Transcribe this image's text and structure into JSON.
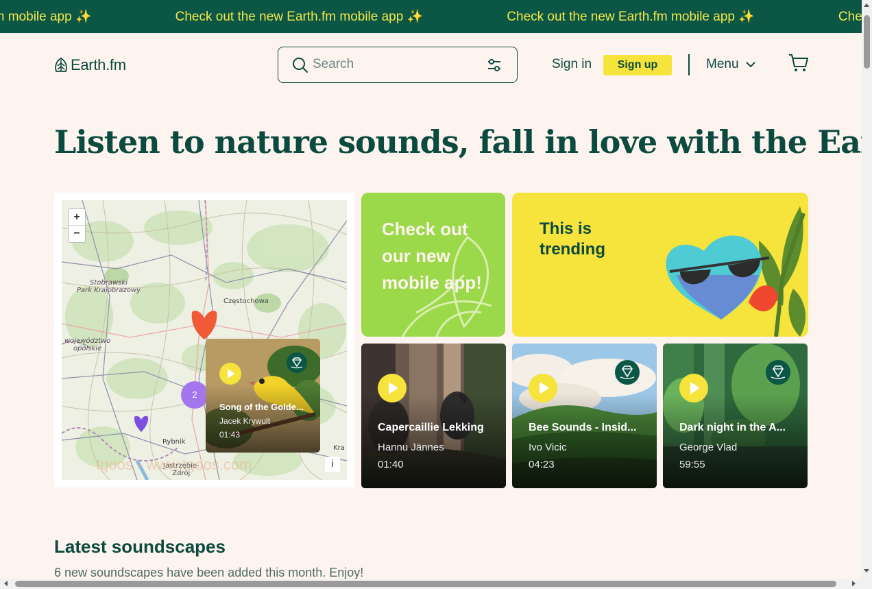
{
  "announcement": {
    "text": "Check out the new Earth.fm mobile app",
    "emoji": "✨",
    "repeats": 4
  },
  "header": {
    "logo_text": "Earth.fm",
    "search_placeholder": "Search",
    "sign_in": "Sign in",
    "sign_up": "Sign up",
    "menu": "Menu"
  },
  "hero": {
    "title": "Listen to nature sounds, fall in love with the Earth"
  },
  "map": {
    "zoom_in": "+",
    "zoom_out": "−",
    "info": "i",
    "labels": {
      "park": "Stobrawski\nPark Krajobrazowy",
      "czestochowa": "Częstochowa",
      "opolskie": "województwo\nopolskie",
      "rybnik": "Rybnik",
      "jastrzebie": "Jastrzębie-\nZdrój",
      "kra": "Kra"
    },
    "cluster_count": "2",
    "popup": {
      "title": "Song of the Golde...",
      "artist": "Jacek Krywult",
      "duration": "01:43"
    }
  },
  "promo": {
    "app_card": "Check out our new mobile app!",
    "trending_card": "This is trending"
  },
  "sounds": [
    {
      "title": "Capercaillie Lekking",
      "artist": "Hannu Jännes",
      "duration": "01:40"
    },
    {
      "title": "Bee Sounds - Insid...",
      "artist": "Ivo Vicic",
      "duration": "04:23"
    },
    {
      "title": "Dark night in the A...",
      "artist": "George Vlad",
      "duration": "59:55"
    }
  ],
  "latest": {
    "title": "Latest soundscapes",
    "subtitle": "6 new soundscapes have been added this month. Enjoy!"
  },
  "watermark": "tgoos - www.tgoos.com",
  "colors": {
    "brand_green": "#0b5644",
    "text_green": "#0b4a3e",
    "accent_yellow": "#f6e33b",
    "lime": "#9cd94a",
    "background": "#fdf3ef"
  },
  "icons": [
    "logo-leaf-icon",
    "search-icon",
    "filter-icon",
    "chevron-down-icon",
    "cart-icon",
    "play-icon",
    "diamond-badge-icon"
  ]
}
